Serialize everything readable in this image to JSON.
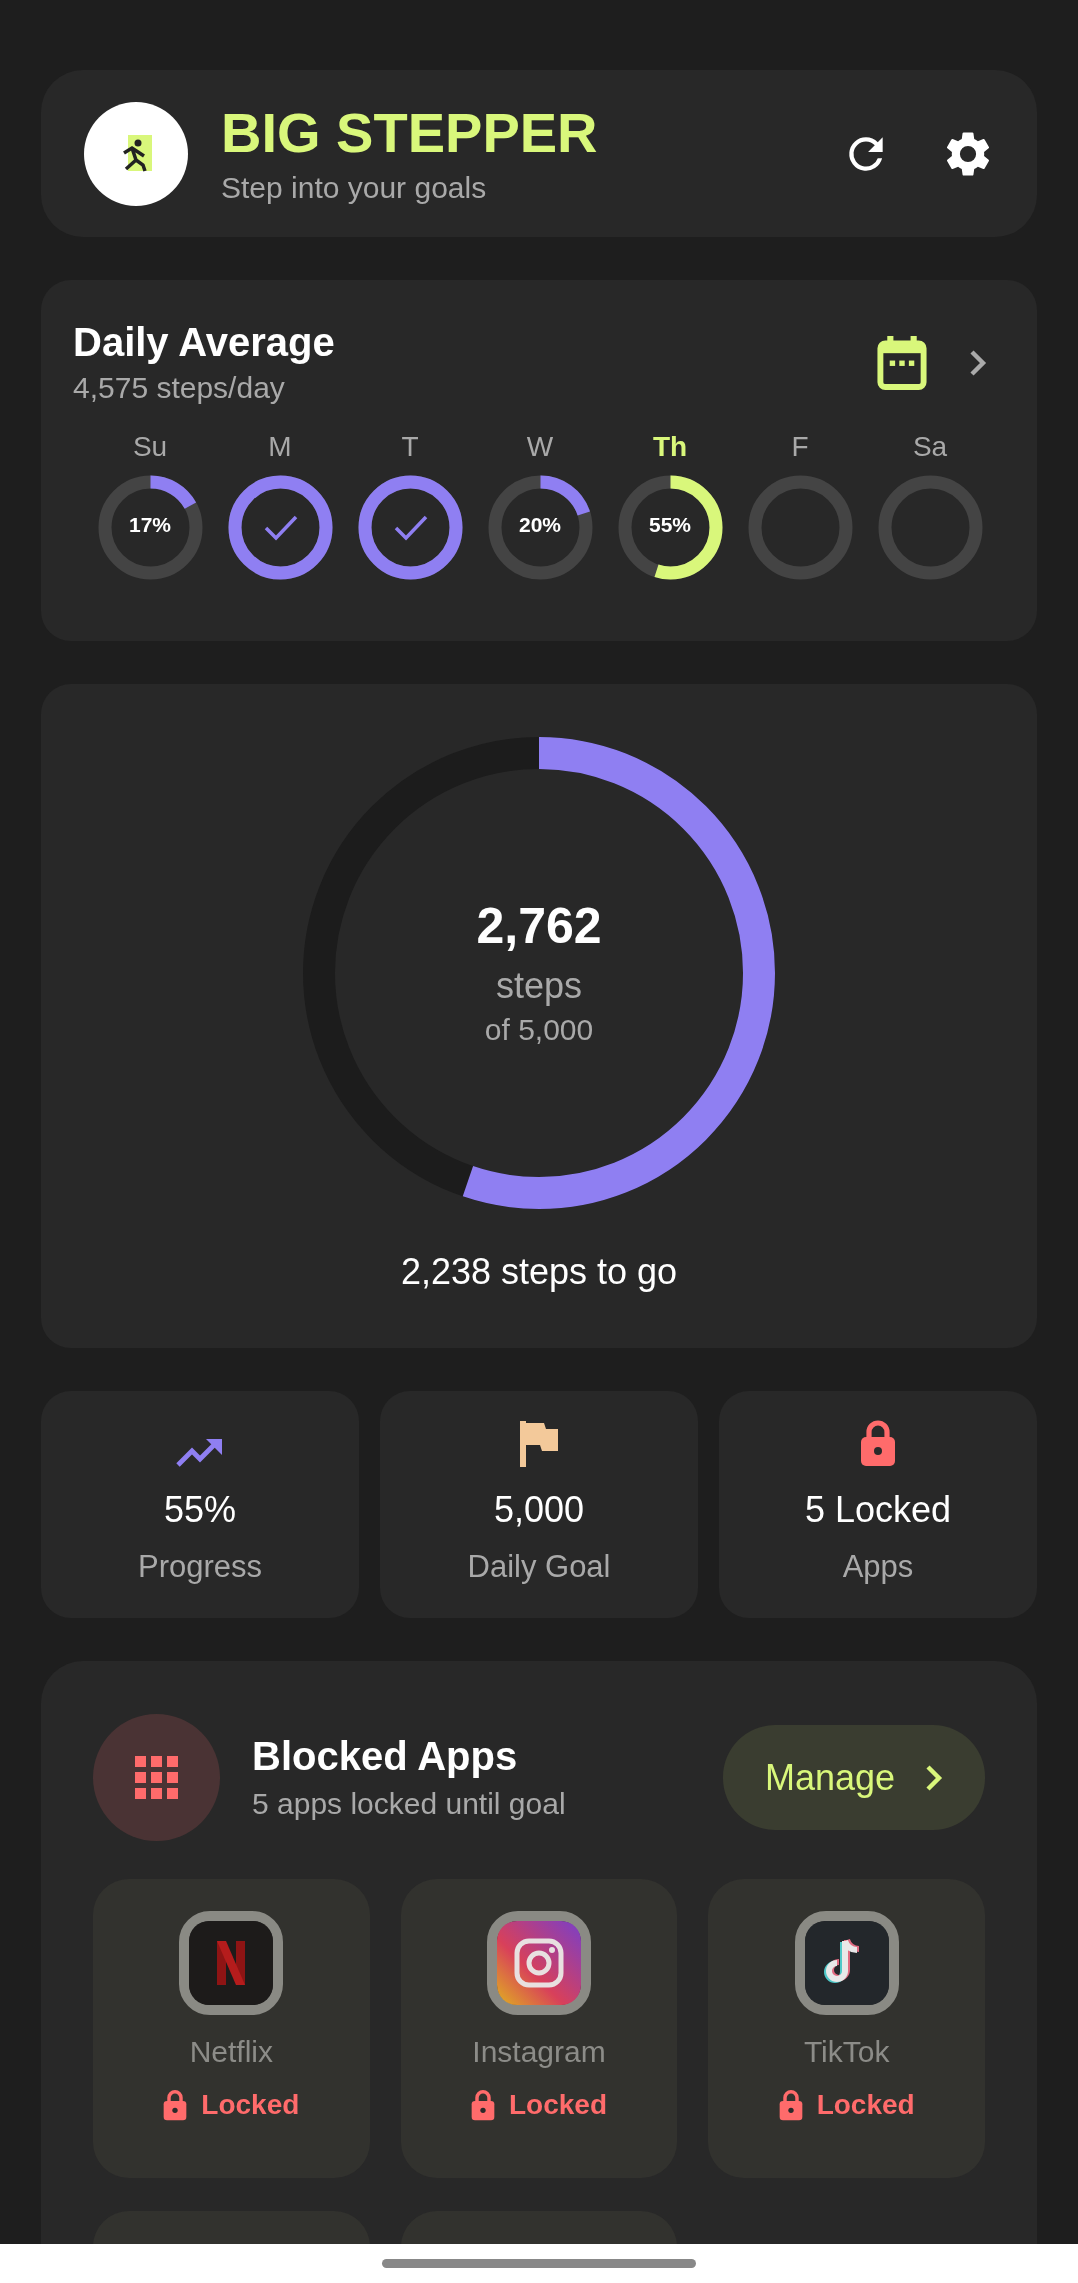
{
  "header": {
    "title": "BIG STEPPER",
    "subtitle": "Step into your goals"
  },
  "daily_average": {
    "title": "Daily Average",
    "subtitle": "4,575 steps/day",
    "days": [
      {
        "label": "Su",
        "kind": "percent",
        "reading": "17%",
        "selected": false
      },
      {
        "label": "M",
        "kind": "done",
        "selected": false
      },
      {
        "label": "T",
        "kind": "done",
        "selected": false
      },
      {
        "label": "W",
        "kind": "percent",
        "reading": "20%",
        "selected": false
      },
      {
        "label": "Th",
        "kind": "percent",
        "reading": "55%",
        "selected": true
      },
      {
        "label": "F",
        "kind": "empty",
        "selected": false
      },
      {
        "label": "Sa",
        "kind": "empty",
        "selected": false
      }
    ]
  },
  "progress": {
    "steps": "2,762",
    "unit": "steps",
    "goal": "of 5,000",
    "remaining": "2,238 steps to go"
  },
  "stats": [
    {
      "kind": "trend",
      "value": "55%",
      "label": "Progress"
    },
    {
      "kind": "flag",
      "value": "5,000",
      "label": "Daily Goal"
    },
    {
      "kind": "lock",
      "value": "5 Locked",
      "label": "Apps"
    }
  ],
  "blocked_apps": {
    "title": "Blocked Apps",
    "subtitle": "5 apps locked until goal",
    "button": "Manage",
    "apps": [
      {
        "kind": "netflix",
        "name": "Netflix",
        "status": "Locked"
      },
      {
        "kind": "instagram",
        "name": "Instagram",
        "status": "Locked"
      },
      {
        "kind": "tiktok",
        "name": "TikTok",
        "status": "Locked"
      },
      {
        "kind": "cut"
      },
      {
        "kind": "cut"
      }
    ]
  }
}
